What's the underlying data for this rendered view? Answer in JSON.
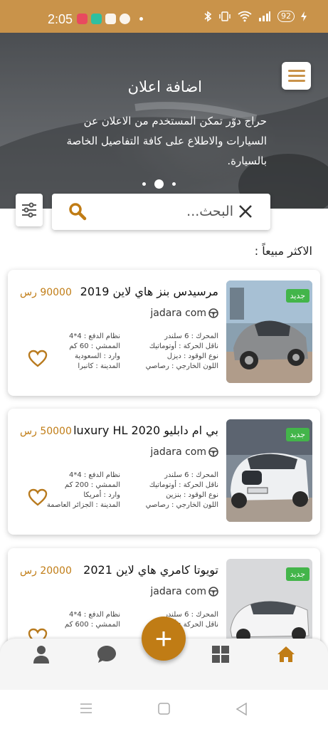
{
  "status_bar": {
    "time": "2:05",
    "battery": "92"
  },
  "hero": {
    "title": "اضافة اعلان",
    "description": "حراج دوّر تمكن المستخدم من الاعلان عن السيارات والاطلاع على كافة التفاصيل الخاصة بالسيارة.",
    "slide_count": 3,
    "active_slide": 2
  },
  "search": {
    "placeholder": "البحث..."
  },
  "section": {
    "title": "الاكثر مبيعاً :"
  },
  "cards": [
    {
      "title": "مرسيدس بنز هاي لاين 2019",
      "price": "90000 رس",
      "seller": "jadara com",
      "badge": "جديد",
      "engine": "المحرك : 6 سلندر",
      "drive": "نظام الدفع : 4*4",
      "transmission": "ناقل الحركة : أوتوماتيك",
      "mileage": "الممشي : 60  كم",
      "fuel": "نوع الوقود : ديزل",
      "import": "وارد : السعودية",
      "color": "اللون الخارجي : رصاصي",
      "city": "المدينة : كانبرا"
    },
    {
      "title": "بي ام دابليو luxury HL 2020",
      "price": "50000 رس",
      "seller": "jadara com",
      "badge": "جديد",
      "engine": "المحرك : 6 سلندر",
      "drive": "نظام الدفع : 4*4",
      "transmission": "ناقل الحركة : أوتوماتيك",
      "mileage": "الممشي : 200  كم",
      "fuel": "نوع الوقود : بنزين",
      "import": "وارد : أمريكا",
      "color": "اللون الخارجي : رصاصي",
      "city": "المدينة : الجزائر العاصمة"
    },
    {
      "title": "تويوتا كامري هاي لاين 2021",
      "price": "20000 رس",
      "seller": "jadara com",
      "badge": "جديد",
      "engine": "المحرك : 6 سلندر",
      "drive": "نظام الدفع : 4*4",
      "transmission": "ناقل الحركة : أوتوماتيك",
      "mileage": "الممشي : 600  كم",
      "fuel": "",
      "import": "",
      "color": "",
      "city": ""
    }
  ],
  "bottom_nav": {
    "items": [
      "home-icon",
      "grid-icon",
      "add-icon",
      "chat-icon",
      "profile-icon"
    ],
    "active": "home-icon",
    "fab_label": "+"
  },
  "colors": {
    "accent": "#c07c15",
    "status_bar": "#c9934a",
    "badge": "#43b54a"
  }
}
